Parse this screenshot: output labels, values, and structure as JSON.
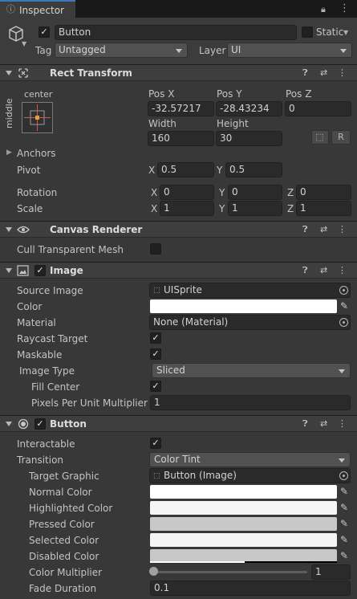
{
  "tab": {
    "label": "Inspector"
  },
  "object": {
    "name": "Button",
    "static_label": "Static",
    "tag_label": "Tag",
    "tag_value": "Untagged",
    "layer_label": "Layer",
    "layer_value": "UI"
  },
  "rect": {
    "title": "Rect Transform",
    "anchor_h": "center",
    "anchor_v": "middle",
    "posx_label": "Pos X",
    "posy_label": "Pos Y",
    "posz_label": "Pos Z",
    "posx": "-32.57217",
    "posy": "-28.43234",
    "posz": "0",
    "width_label": "Width",
    "height_label": "Height",
    "width": "160",
    "height": "30",
    "r_button": "R",
    "anchors_label": "Anchors",
    "pivot_label": "Pivot",
    "pivot_x": "0.5",
    "pivot_y": "0.5",
    "rotation_label": "Rotation",
    "rot_x": "0",
    "rot_y": "0",
    "rot_z": "0",
    "scale_label": "Scale",
    "scale_x": "1",
    "scale_y": "1",
    "scale_z": "1",
    "x": "X",
    "y": "Y",
    "z": "Z"
  },
  "canvas": {
    "title": "Canvas Renderer",
    "cull_label": "Cull Transparent Mesh"
  },
  "image": {
    "title": "Image",
    "source_label": "Source Image",
    "source_value": "UISprite",
    "color_label": "Color",
    "material_label": "Material",
    "material_value": "None (Material)",
    "raycast_label": "Raycast Target",
    "maskable_label": "Maskable",
    "type_label": "Image Type",
    "type_value": "Sliced",
    "fill_label": "Fill Center",
    "ppu_label": "Pixels Per Unit Multiplier",
    "ppu_value": "1"
  },
  "button": {
    "title": "Button",
    "interactable_label": "Interactable",
    "transition_label": "Transition",
    "transition_value": "Color Tint",
    "target_label": "Target Graphic",
    "target_value": "Button (Image)",
    "normal_label": "Normal Color",
    "highlighted_label": "Highlighted Color",
    "pressed_label": "Pressed Color",
    "selected_label": "Selected Color",
    "disabled_label": "Disabled Color",
    "multiplier_label": "Color Multiplier",
    "multiplier_value": "1",
    "multiplier_level": 0,
    "fade_label": "Fade Duration",
    "fade_value": "0.1",
    "colors": {
      "normal": "#ffffff",
      "highlighted": "#f5f5f5",
      "pressed": "#c8c8c8",
      "selected": "#f5f5f5",
      "disabled": "#c8c8c8"
    }
  }
}
